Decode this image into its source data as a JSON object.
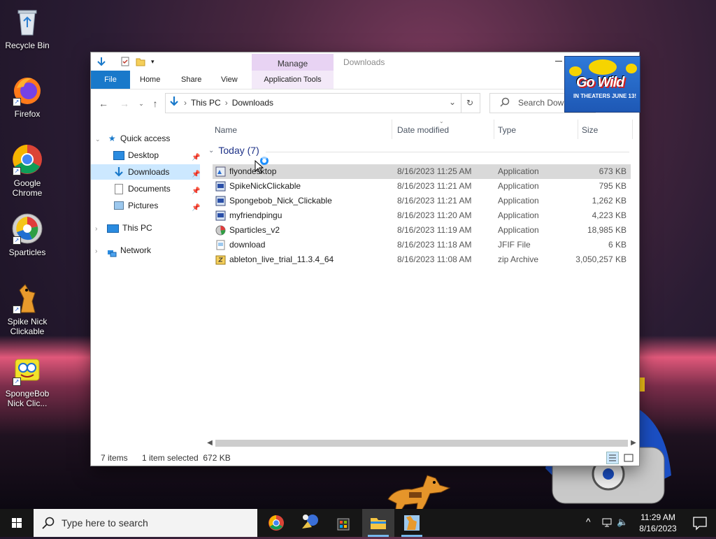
{
  "desktop": {
    "icons": [
      {
        "label": "Recycle Bin"
      },
      {
        "label": "Firefox"
      },
      {
        "label": "Google Chrome"
      },
      {
        "label": "Sparticles"
      },
      {
        "label": "Spike Nick Clickable"
      },
      {
        "label": "SpongeBob Nick Clic..."
      }
    ]
  },
  "window": {
    "context_tab": "Manage",
    "title": "Downloads",
    "ribbon_tabs": [
      "File",
      "Home",
      "Share",
      "View",
      "Application Tools"
    ],
    "address": {
      "crumbs": [
        "This PC",
        "Downloads"
      ]
    },
    "search_placeholder": "Search Downloads",
    "nav": {
      "quick_access": "Quick access",
      "desktop": "Desktop",
      "downloads": "Downloads",
      "documents": "Documents",
      "pictures": "Pictures",
      "this_pc": "This PC",
      "network": "Network"
    },
    "columns": {
      "name": "Name",
      "date": "Date modified",
      "type": "Type",
      "size": "Size"
    },
    "group_label": "Today (7)",
    "files": [
      {
        "name": "flyondesktop",
        "date": "8/16/2023 11:25 AM",
        "type": "Application",
        "size": "673 KB",
        "selected": true
      },
      {
        "name": "SpikeNickClickable",
        "date": "8/16/2023 11:21 AM",
        "type": "Application",
        "size": "795 KB"
      },
      {
        "name": "Spongebob_Nick_Clickable",
        "date": "8/16/2023 11:21 AM",
        "type": "Application",
        "size": "1,262 KB"
      },
      {
        "name": "myfriendpingu",
        "date": "8/16/2023 11:20 AM",
        "type": "Application",
        "size": "4,223 KB"
      },
      {
        "name": "Sparticles_v2",
        "date": "8/16/2023 11:19 AM",
        "type": "Application",
        "size": "18,985 KB"
      },
      {
        "name": "download",
        "date": "8/16/2023 11:18 AM",
        "type": "JFIF File",
        "size": "6 KB"
      },
      {
        "name": "ableton_live_trial_11.3.4_64",
        "date": "8/16/2023 11:08 AM",
        "type": "zip Archive",
        "size": "3,050,257 KB"
      }
    ],
    "status": {
      "count": "7 items",
      "selection": "1 item selected  672 KB"
    }
  },
  "ad": {
    "headline": "Go Wild",
    "sub": "IN THEATERS JUNE 13!"
  },
  "taskbar": {
    "search_placeholder": "Type here to search",
    "time": "11:29 AM",
    "date": "8/16/2023"
  },
  "colors": {
    "accent": "#1979ca",
    "selection": "#cce8ff",
    "context_tab": "#e8d3f3",
    "taskbar": "#161616"
  }
}
